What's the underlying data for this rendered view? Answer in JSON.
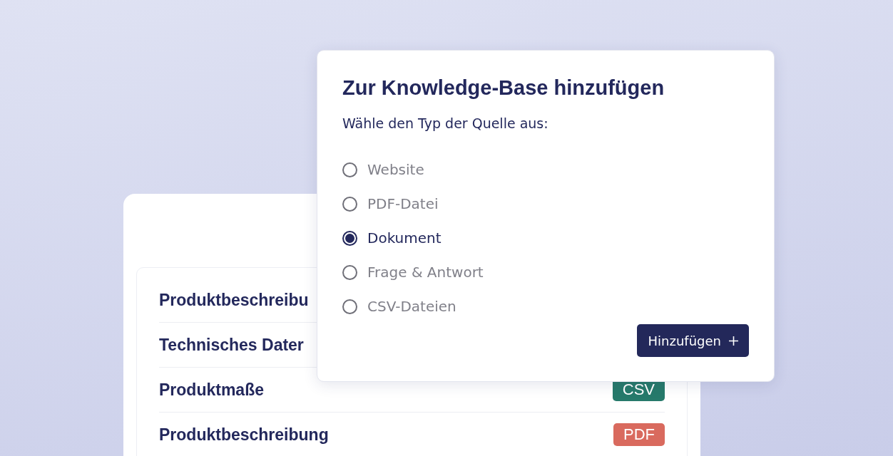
{
  "sources_list": {
    "rows": [
      {
        "name": "Produktbeschreibu"
      },
      {
        "name": "Technisches Dater"
      },
      {
        "name": "Produktmaße",
        "badge": {
          "label": "CSV",
          "color": "#267a6b"
        }
      },
      {
        "name": "Produktbeschreibung",
        "badge": {
          "label": "PDF",
          "color": "#d96a5e"
        }
      }
    ]
  },
  "dialog": {
    "title": "Zur Knowledge-Base hinzufügen",
    "subtitle": "Wähle den Typ der Quelle aus:",
    "options": [
      {
        "label": "Website",
        "selected": false
      },
      {
        "label": "PDF-Datei",
        "selected": false
      },
      {
        "label": "Dokument",
        "selected": true
      },
      {
        "label": "Frage & Antwort",
        "selected": false
      },
      {
        "label": "CSV-Dateien",
        "selected": false
      }
    ],
    "button": {
      "label": "Hinzufügen"
    }
  }
}
